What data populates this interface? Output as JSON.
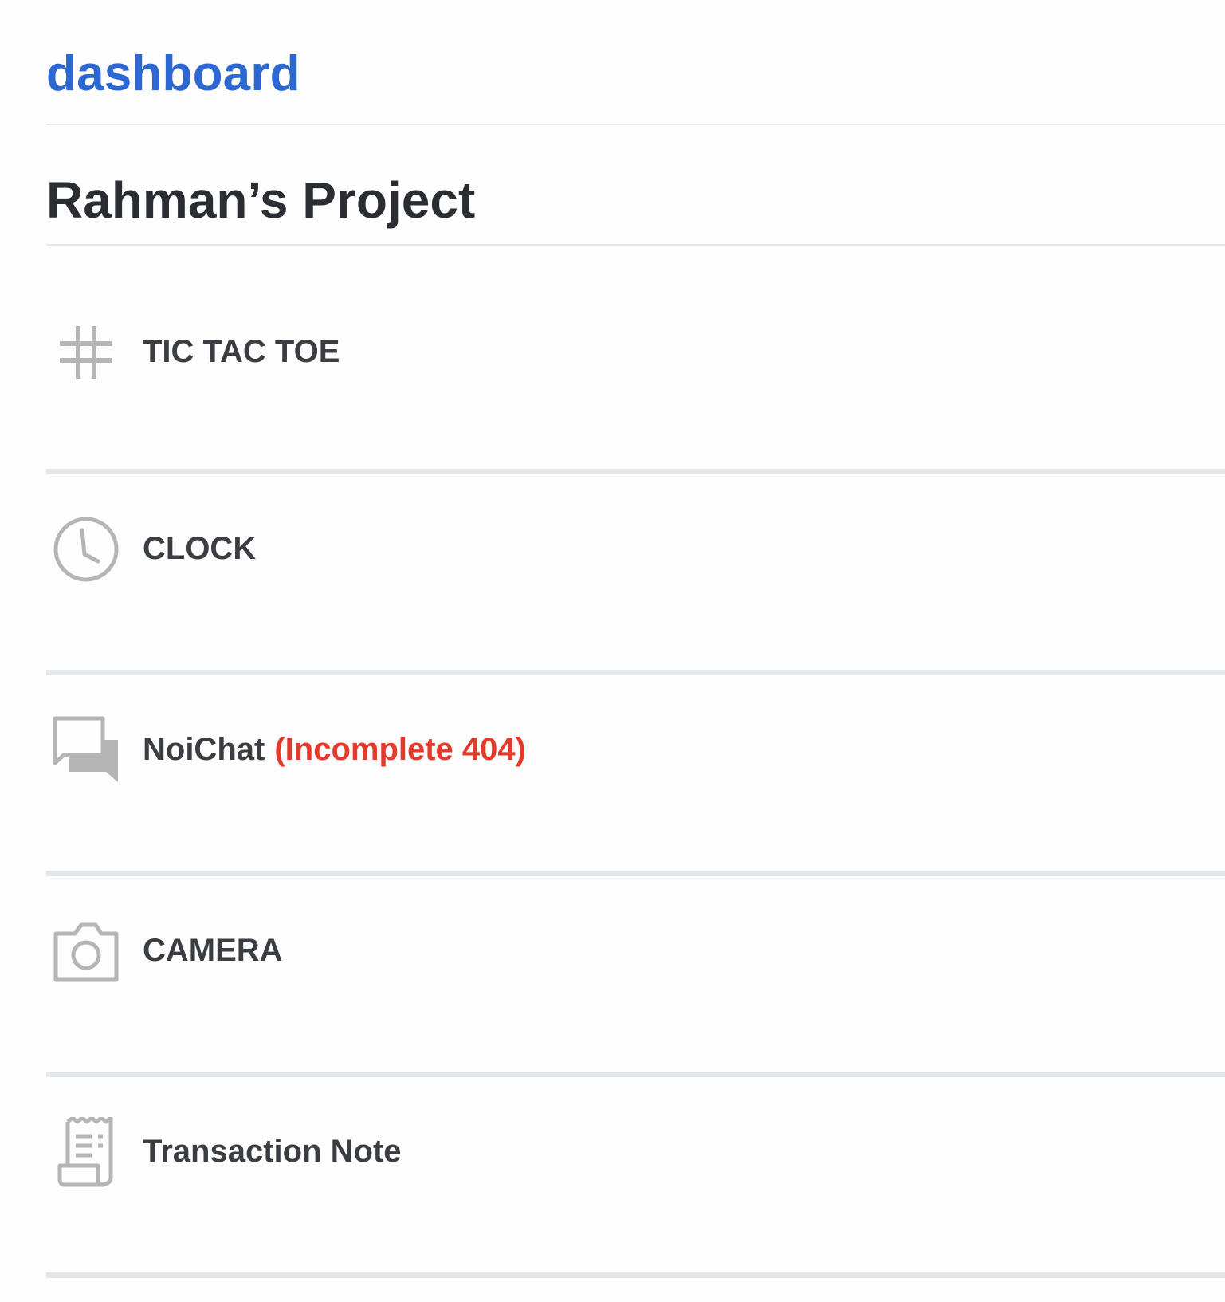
{
  "brand": {
    "label": "dashboard"
  },
  "page": {
    "title": "Rahman’s Project"
  },
  "projects": [
    {
      "label": "TIC TAC TOE",
      "icon": "hash-icon"
    },
    {
      "label": "CLOCK",
      "icon": "clock-icon"
    },
    {
      "label": "NoiChat",
      "badge": "(Incomplete 404)",
      "icon": "chat-icon"
    },
    {
      "label": "CAMERA",
      "icon": "camera-icon"
    },
    {
      "label": "Transaction Note",
      "icon": "receipt-icon"
    }
  ],
  "colors": {
    "brand": "#2d67d1",
    "title": "#2a2d31",
    "item_text": "#3a3d41",
    "icon": "#b5b5b5",
    "badge": "#e33a2b",
    "divider": "#e3e6ea"
  }
}
